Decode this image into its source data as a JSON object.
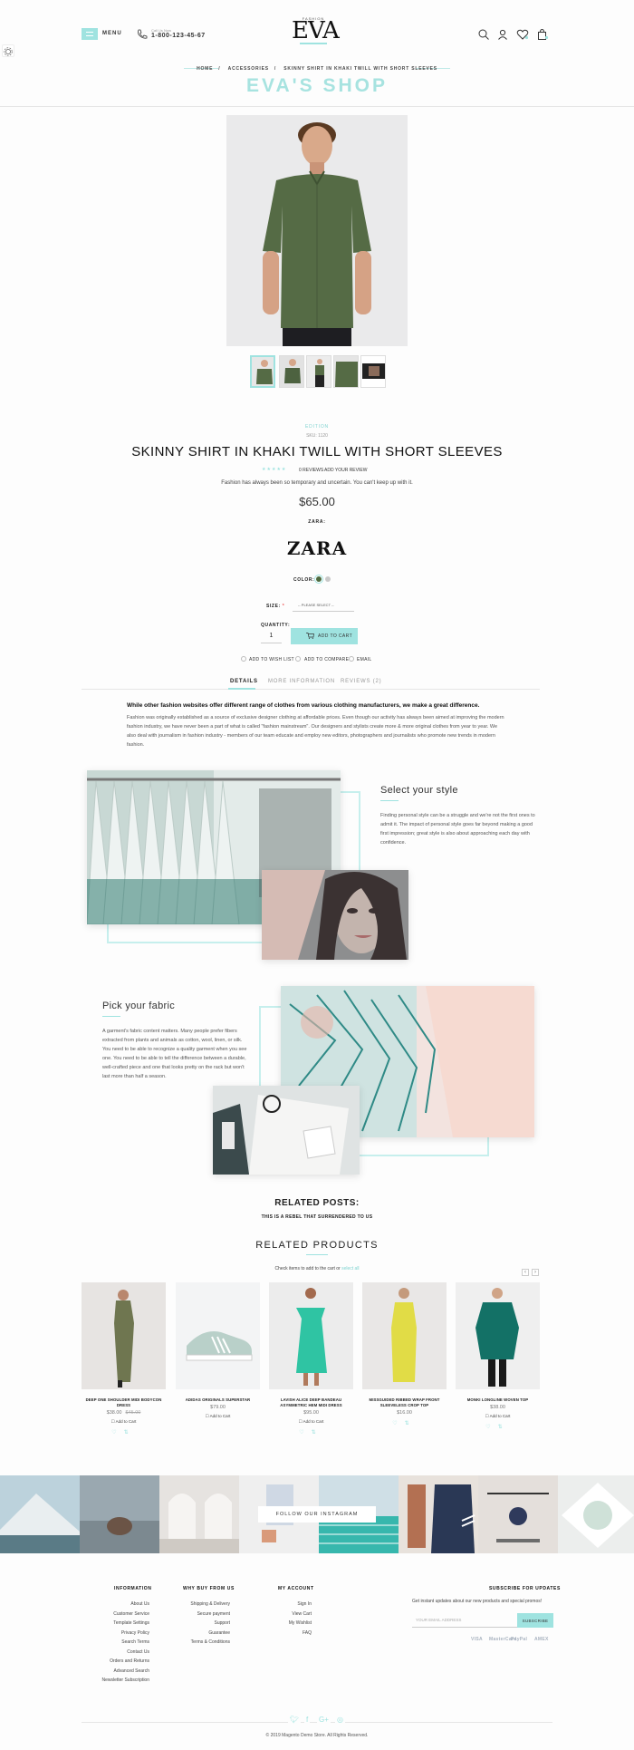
{
  "header": {
    "menu_label": "MENU",
    "phone_small": "Call Us Now",
    "phone_number": "1-800-123-45-67",
    "logo_tagline": "FASHION",
    "logo_text": "EVA"
  },
  "breadcrumb": [
    "HOME",
    "ACCESSORIES",
    "SKINNY SHIRT IN KHAKI TWILL WITH SHORT SLEEVES"
  ],
  "shop_title": "EVA'S SHOP",
  "product": {
    "category": "EDITION",
    "sku": "SKU: 1120",
    "title": "SKINNY SHIRT IN KHAKI TWILL WITH SHORT SLEEVES",
    "stars": "★★★★★",
    "reviews_count": "0 REVIEWS",
    "add_review": "ADD YOUR REVIEW",
    "short_description": "Fashion has always been so temporary and uncertain. You can't keep up with it.",
    "price": "$65.00",
    "brand_label": "ZARA:",
    "brand": "ZARA",
    "color_label": "COLOR:",
    "colors": [
      "#4f6b3f",
      "#c9c9c9"
    ],
    "size_label": "SIZE:",
    "size_placeholder": "-- PLEASE SELECT --",
    "qty_label": "QUANTITY:",
    "qty_value": "1",
    "add_to_cart": "ADD TO CART",
    "wishlist": "ADD TO WISH LIST",
    "compare": "ADD TO COMPARE",
    "email": "EMAIL"
  },
  "tabs": [
    "DETAILS",
    "MORE INFORMATION",
    "REVIEWS (2)"
  ],
  "details": {
    "lead": "While other fashion websites offer different range of clothes from various clothing manufacturers, we make a great difference.",
    "body": "Fashion was originally established as a source of exclusive designer clothing at affordable prices. Even though our activity has always been aimed at improving the modern fashion industry, we have never been a part of what is called \"fashion mainstream\". Our designers and stylists create more & more original clothes from year to year. We also deal with journalism in fashion industry - members of our team educate and employ new editors, photographers and journalists who promote new trends in modern fashion."
  },
  "editorial": {
    "style_title": "Select your style",
    "style_body": "Finding personal style can be a struggle and we're not the first ones to admit it. The impact of personal style goes far beyond making a good first impression; great style is also about approaching each day with confidence.",
    "fabric_title": "Pick your fabric",
    "fabric_body": "A garment's fabric content matters. Many people prefer fibers extracted from plants and animals as cotton, wool, linen, or silk. You need to be able to recognize a quality garment when you see one. You need to be able to tell the difference between a durable, well-crafted piece and one that looks pretty on the rack but won't last more than half a season."
  },
  "related_posts": {
    "title": "RELATED POSTS:",
    "item": "THIS IS A REBEL THAT SURRENDERED TO US"
  },
  "related_products": {
    "title": "RELATED PRODUCTS",
    "hint": "Check items to add to the cart or",
    "hint_link": "select all",
    "prev": "‹",
    "next": "›",
    "add_label": "Add to Cart",
    "items": [
      {
        "name": "DEEP ONE SHOULDER MIDI BODYCON DRESS",
        "price": "$38.00",
        "old_price": "$45.00"
      },
      {
        "name": "ADIDAS ORIGINALS SUPERSTAR",
        "price": "$79.00",
        "old_price": ""
      },
      {
        "name": "LAVISH ALICE DEEP BANDEAU ASYMMETRIC HEM MIDI DRESS",
        "price": "$95.00",
        "old_price": ""
      },
      {
        "name": "MISSGUIDED RIBBED WRAP FRONT SLEEVELESS CROP TOP",
        "price": "$16.00",
        "old_price": ""
      },
      {
        "name": "MONKI LONGLINE WOVEN TOP",
        "price": "$38.00",
        "old_price": ""
      }
    ]
  },
  "instagram": {
    "button": "FOLLOW OUR INSTAGRAM"
  },
  "footer": {
    "columns": [
      {
        "title": "INFORMATION",
        "links": [
          "About Us",
          "Customer Service",
          "Template Settings",
          "Privacy Policy",
          "Search Terms",
          "Contact Us",
          "Orders and Returns",
          "Advanced Search",
          "Newsletter Subscription"
        ]
      },
      {
        "title": "WHY BUY FROM US",
        "links": [
          "Shipping & Delivery",
          "Secure payment",
          "Support",
          "Guarantee",
          "Terms & Conditions"
        ]
      },
      {
        "title": "MY ACCOUNT",
        "links": [
          "Sign In",
          "View Cart",
          "My Wishlist",
          "FAQ"
        ]
      }
    ],
    "subscribe_title": "SUBSCRIBE FOR UPDATES",
    "subscribe_text": "Get instant updates about our new products and special promos!",
    "email_placeholder": "YOUR EMAIL ADDRESS",
    "subscribe_button": "SUBSCRIBE",
    "payments": [
      "VISA",
      "MasterCard",
      "PayPal",
      "AMEX"
    ],
    "copyright": "© 2019 Magento Demo Store. All Rights Reserved."
  },
  "colors": {
    "accent": "#9fe3e0",
    "text": "#222222"
  }
}
